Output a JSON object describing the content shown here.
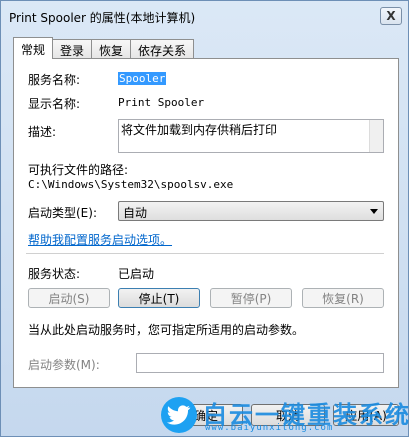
{
  "window": {
    "title": "Print Spooler 的属性(本地计算机)",
    "close_glyph": "X"
  },
  "tabs": [
    {
      "label": "常规",
      "active": true
    },
    {
      "label": "登录",
      "active": false
    },
    {
      "label": "恢复",
      "active": false
    },
    {
      "label": "依存关系",
      "active": false
    }
  ],
  "general": {
    "service_name_label": "服务名称:",
    "service_name_value": "Spooler",
    "display_name_label": "显示名称:",
    "display_name_value": "Print Spooler",
    "description_label": "描述:",
    "description_value": "将文件加载到内存供稍后打印",
    "exe_path_label": "可执行文件的路径:",
    "exe_path_value": "C:\\Windows\\System32\\spoolsv.exe",
    "startup_type_label": "启动类型(E):",
    "startup_type_value": "自动",
    "help_link": "帮助我配置服务启动选项。",
    "status_label": "服务状态:",
    "status_value": "已启动",
    "buttons": {
      "start": "启动(S)",
      "stop": "停止(T)",
      "pause": "暂停(P)",
      "resume": "恢复(R)"
    },
    "hint": "当从此处启动服务时，您可指定所适用的启动参数。",
    "start_params_label": "启动参数(M):",
    "start_params_value": ""
  },
  "footer": {
    "ok": "确定",
    "cancel": "取消",
    "apply": "应用(A)"
  },
  "watermark": {
    "text": "白云一键重装系统",
    "url": "www.baiyunxitong.com"
  }
}
